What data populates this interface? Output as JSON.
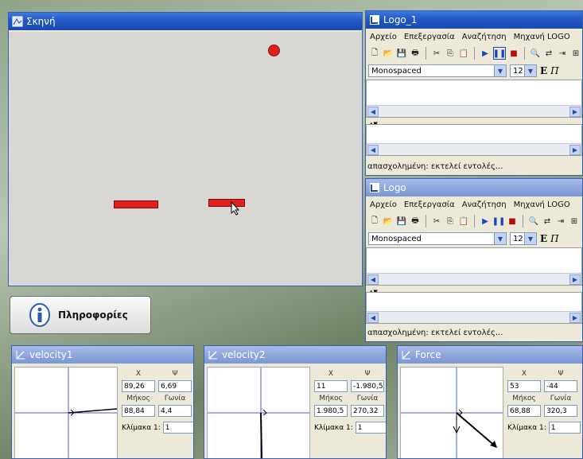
{
  "scene": {
    "title": "Σκηνή"
  },
  "info_button": {
    "label": "Πληροφορίες"
  },
  "logo_windows": [
    {
      "title": "Logo_1",
      "menu": [
        "Αρχείο",
        "Επεξεργασία",
        "Αναζήτηση",
        "Μηχανή LOGO"
      ],
      "font": "Monospaced",
      "size": "12",
      "status": "απασχολημένη: εκτελεί εντολές..."
    },
    {
      "title": "Logo",
      "menu": [
        "Αρχείο",
        "Επεξεργασία",
        "Αναζήτηση",
        "Μηχανή LOGO"
      ],
      "font": "Monospaced",
      "size": "12",
      "status": "απασχολημένη: εκτελεί εντολές..."
    }
  ],
  "vector_panels": [
    {
      "title": "velocity1",
      "x_label": "X",
      "y_label": "Ψ",
      "x": "89,26",
      "y": "6,69",
      "len_label": "Μήκος",
      "angle_label": "Γωνία",
      "length": "88,84",
      "angle": "4,4",
      "scale_label": "Κλίμακα 1:",
      "scale": "1"
    },
    {
      "title": "velocity2",
      "x_label": "X",
      "y_label": "Ψ",
      "x": "11",
      "y": "-1.980,5",
      "len_label": "Μήκος",
      "angle_label": "Γωνία",
      "length": "1.980,5",
      "angle": "270,32",
      "scale_label": "Κλίμακα 1:",
      "scale": "1"
    },
    {
      "title": "Force",
      "x_label": "X",
      "y_label": "Ψ",
      "x": "53",
      "y": "-44",
      "len_label": "Μήκος",
      "angle_label": "Γωνία",
      "length": "68,88",
      "angle": "320,3",
      "scale_label": "Κλίμακα 1:",
      "scale": "1"
    }
  ],
  "colors": {
    "ball": "#e01e1e",
    "paddle": "#e02020",
    "titlebar": "#2457c6"
  }
}
